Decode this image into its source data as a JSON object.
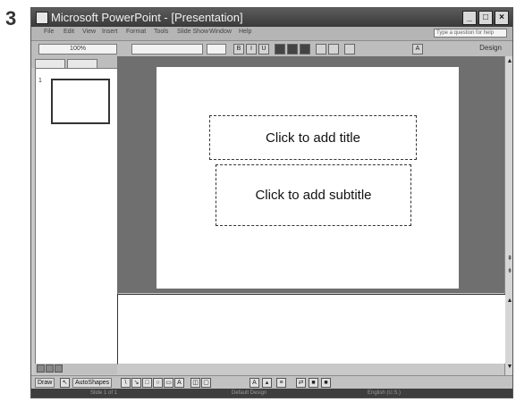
{
  "step_number": "3",
  "window": {
    "title": "Microsoft PowerPoint - [Presentation]",
    "controls": [
      "_",
      "□",
      "×"
    ]
  },
  "menubar": {
    "items": [
      "File",
      "Edit",
      "View",
      "Insert",
      "Format",
      "Tools",
      "Slide Show",
      "Window",
      "Help"
    ],
    "help_placeholder": "Type a question for help"
  },
  "toolbar": {
    "zoom": "100%",
    "bold": "B",
    "italic": "I",
    "underline": "U",
    "font_color": "A",
    "design_label": "Design"
  },
  "slides_pane": {
    "slide_number": "1"
  },
  "slide": {
    "title_placeholder": "Click to add title",
    "subtitle_placeholder": "Click to add subtitle"
  },
  "draw_toolbar": {
    "draw_label": "Draw",
    "autoshapes_label": "AutoShapes"
  },
  "statusbar": {
    "slide_info": "Slide 1 of 1",
    "design": "Default Design",
    "language": "English (U.S.)"
  }
}
